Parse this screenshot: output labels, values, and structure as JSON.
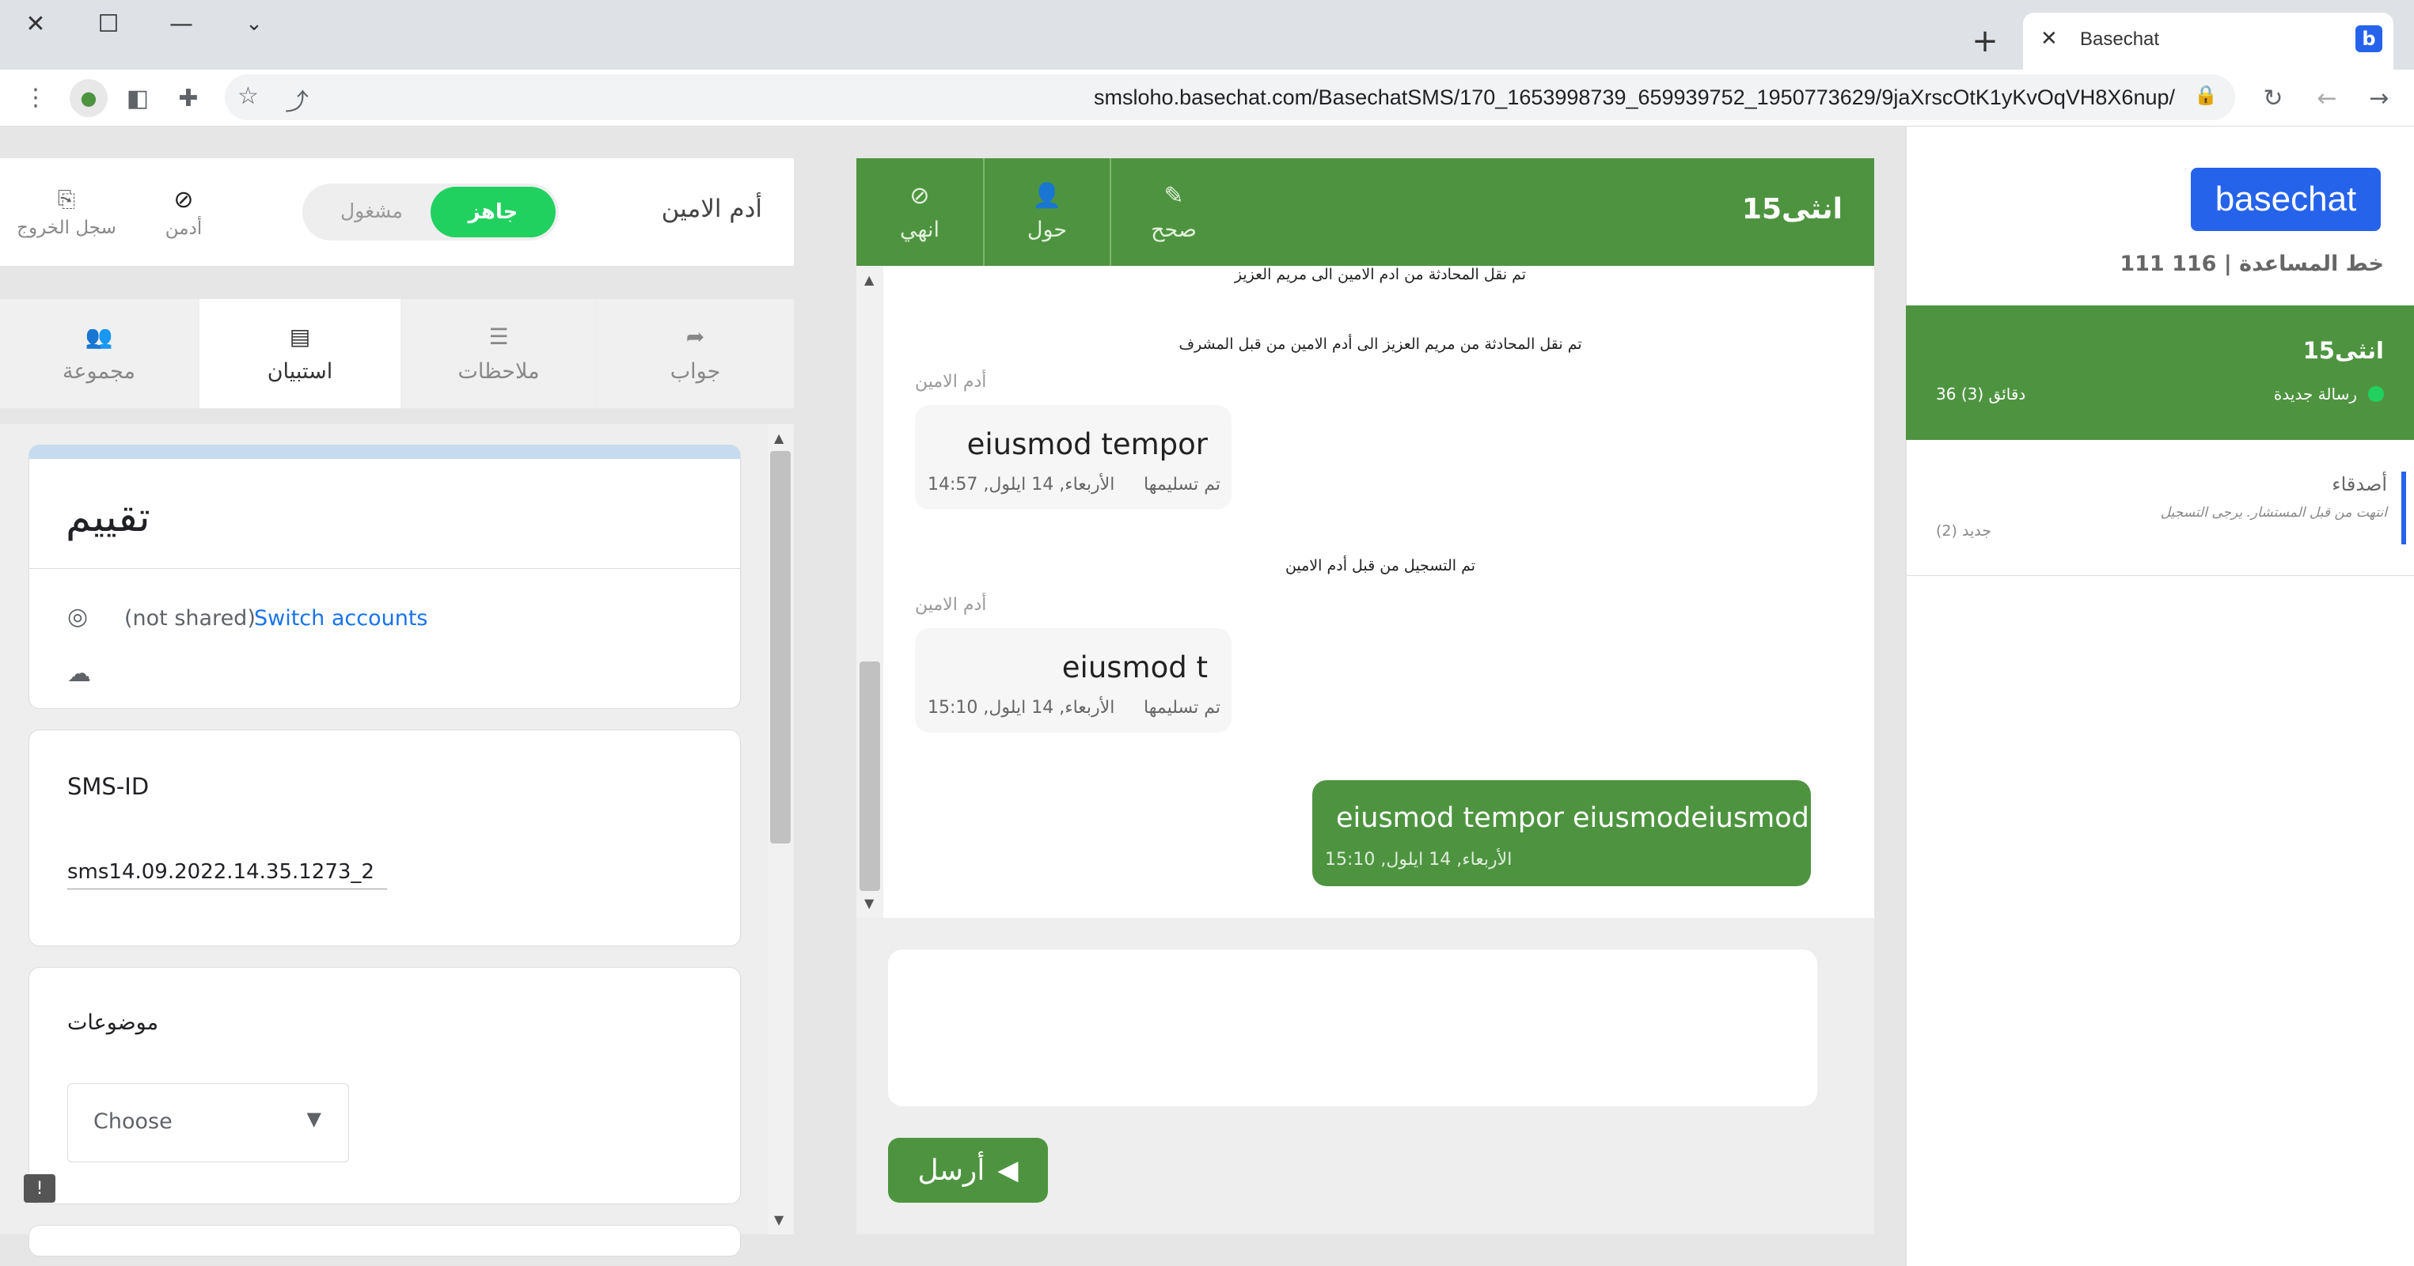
{
  "browser": {
    "tab_title": "Basechat",
    "url": "smsloho.basechat.com/BasechatSMS/170_1653998739_659939752_1950773629/9jaXrscOtK1yKvOqVH8X6nup/"
  },
  "agent": {
    "name": "أدم الامين",
    "status_ready": "جاهز",
    "status_busy": "مشغول",
    "admin_label": "أدمن",
    "logout_label": "سجل الخروج"
  },
  "panel_tabs": [
    {
      "label": "مجموعة",
      "icon": "group-icon"
    },
    {
      "label": "استبيان",
      "icon": "form-icon"
    },
    {
      "label": "ملاحظات",
      "icon": "notes-icon"
    },
    {
      "label": "جواب",
      "icon": "reply-icon"
    }
  ],
  "form": {
    "title": "تقييم",
    "not_shared": "(not shared)",
    "switch_accounts": "Switch accounts",
    "sms_id_label": "SMS-ID",
    "sms_id_value": "sms14.09.2022.14.35.1273_2",
    "topics_label": "موضوعات",
    "choose_placeholder": "Choose"
  },
  "chat": {
    "title": "انثى15",
    "actions": [
      {
        "label": "صحح",
        "icon": "pencil-icon"
      },
      {
        "label": "حول",
        "icon": "person-icon"
      },
      {
        "label": "انهي",
        "icon": "block-icon"
      }
    ],
    "system_messages": [
      "تم نقل المحادثة من ادم الامين الى مريم العزيز",
      "تم نقل المحادثة من مريم العزيز الى أدم الامين من قبل المشرف",
      "تم التسجيل من قبل أدم الامين"
    ],
    "messages": [
      {
        "sender": "أدم الامين",
        "text": "eiusmod tempor",
        "status": "تم تسليمها",
        "time": "الأربعاء, 14 ايلول, 14:57"
      },
      {
        "sender": "أدم الامين",
        "text": "eiusmod t",
        "status": "تم تسليمها",
        "time": "الأربعاء, 14 ايلول, 15:10"
      }
    ],
    "outgoing": {
      "text": "eiusmod tempor eiusmodeiusmod",
      "time": "الأربعاء, 14 ايلول, 15:10"
    },
    "send_label": "أرسل"
  },
  "sidebar": {
    "logo": "basechat",
    "helpline_label": "خط المساعدة |",
    "helpline_number": "116 111",
    "active_conv": {
      "name": "انثى15",
      "status": "رسالة جديدة",
      "wait": "36 دقائق (3)"
    },
    "friends": {
      "name": "أصدقاء",
      "desc": "انتهت من قبل المستشار. يرجى التسجيل",
      "count": "جديد (2)"
    }
  },
  "colors": {
    "green": "#4e9440",
    "ready": "#21d160",
    "brand": "#2563eb"
  }
}
